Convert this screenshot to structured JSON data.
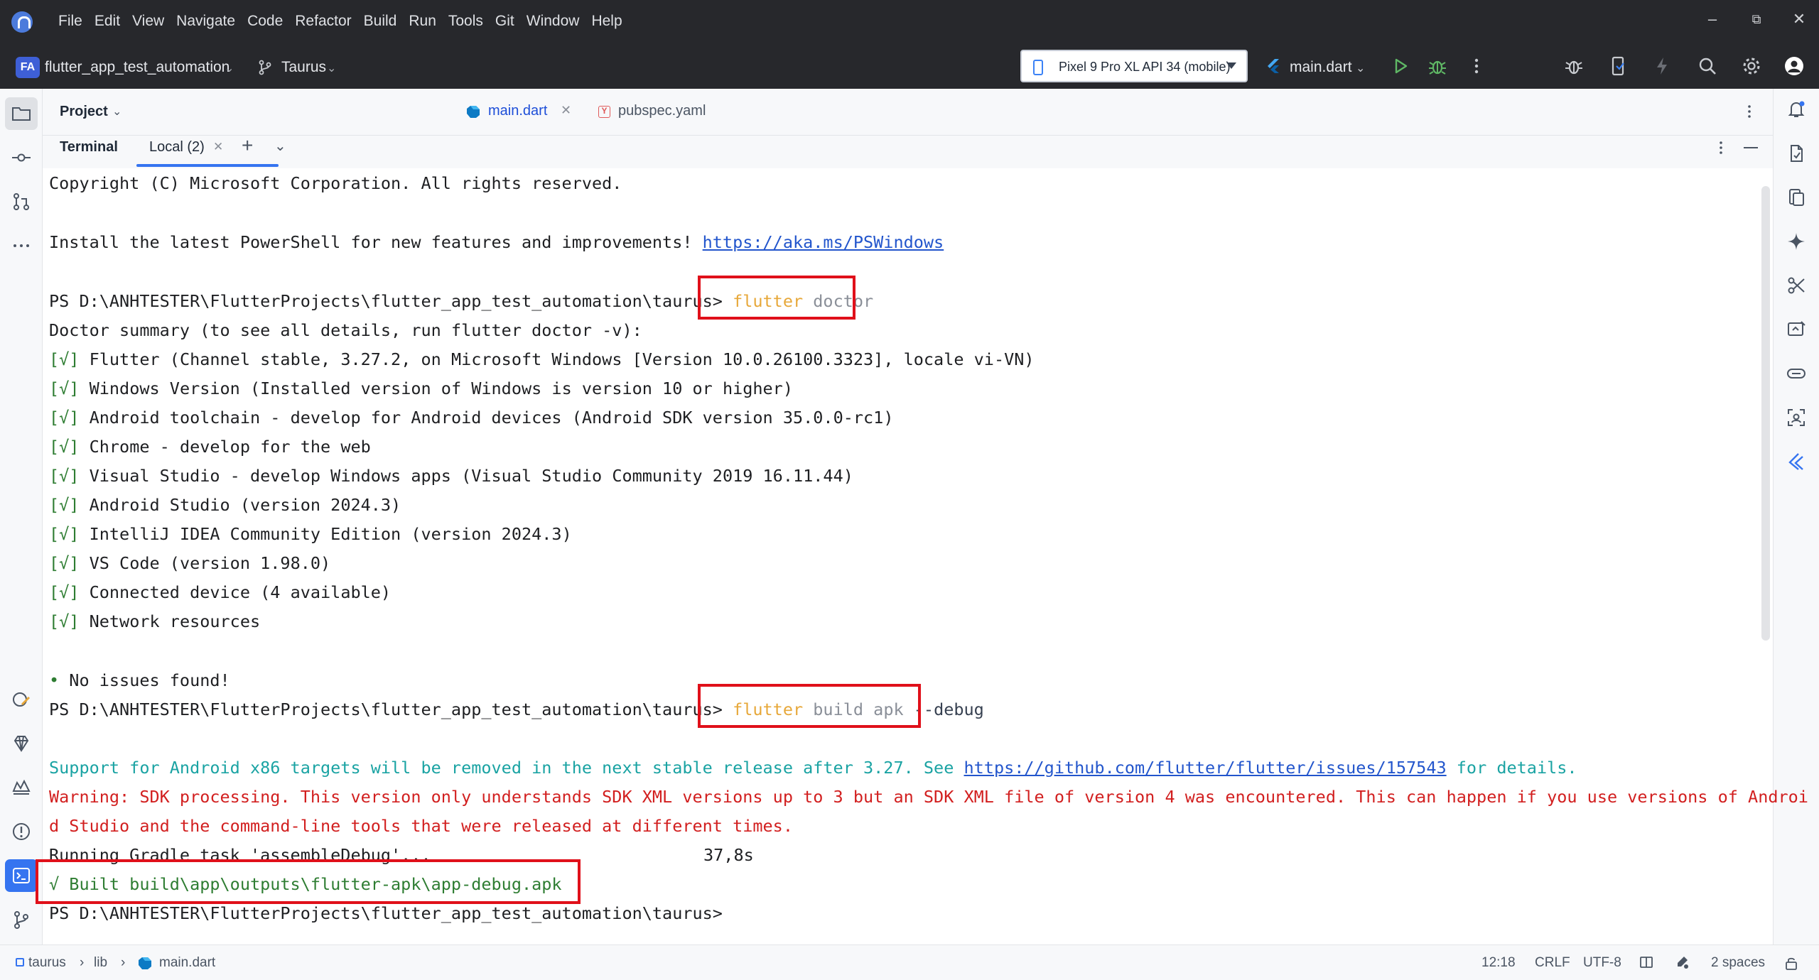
{
  "menu": [
    "File",
    "Edit",
    "View",
    "Navigate",
    "Code",
    "Refactor",
    "Build",
    "Run",
    "Tools",
    "Git",
    "Window",
    "Help"
  ],
  "window_controls": {
    "minimize": "–",
    "restore": "⧉",
    "close": "✕"
  },
  "toolbar": {
    "project_badge": "FA",
    "project_name": "flutter_app_test_automation",
    "branch": "Taurus",
    "device": "Pixel 9 Pro XL API 34 (mobile)",
    "run_config": "main.dart"
  },
  "project_panel": {
    "label": "Project"
  },
  "editor_tabs": [
    {
      "label": "main.dart",
      "icon": "dart-icon",
      "active": true
    },
    {
      "label": "pubspec.yaml",
      "icon": "yaml-icon",
      "active": false
    }
  ],
  "terminal": {
    "title": "Terminal",
    "tab": "Local (2)",
    "lines": {
      "copyright": "Copyright (C) Microsoft Corporation. All rights reserved.",
      "install_prefix": "Install the latest PowerShell for new features and improvements! ",
      "install_link": "https://aka.ms/PSWindows",
      "prompt": "PS D:\\ANHTESTER\\FlutterProjects\\flutter_app_test_automation\\taurus>",
      "cmd1_flutter": "flutter",
      "cmd1_arg": " doctor",
      "doctor_summary": "Doctor summary (to see all details, run flutter doctor -v):",
      "check_mark": "[√]",
      "checks": [
        "Flutter (Channel stable, 3.27.2, on Microsoft Windows [Version 10.0.26100.3323], locale vi-VN)",
        "Windows Version (Installed version of Windows is version 10 or higher)",
        "Android toolchain - develop for Android devices (Android SDK version 35.0.0-rc1)",
        "Chrome - develop for the web",
        "Visual Studio - develop Windows apps (Visual Studio Community 2019 16.11.44)",
        "Android Studio (version 2024.3)",
        "IntelliJ IDEA Community Edition (version 2024.3)",
        "VS Code (version 1.98.0)",
        "Connected device (4 available)",
        "Network resources"
      ],
      "no_issues_bullet": "•",
      "no_issues": " No issues found!",
      "cmd2_flutter": "flutter",
      "cmd2_arg": " build apk",
      "cmd2_flag": " --debug",
      "support_text": "Support for Android x86 targets will be removed in the next stable release after 3.27. See ",
      "support_link": "https://github.com/flutter/flutter/issues/157543",
      "support_suffix": " for details.",
      "warning_1": "Warning: SDK processing. This version only understands SDK XML versions up to 3 but an SDK XML file of version 4 was encountered. This can happen if you use versions of Androi",
      "warning_2": "d Studio and the command-line tools that were released at different times.",
      "gradle_task": "Running Gradle task 'assembleDebug'...",
      "gradle_time": "37,8s",
      "built": "√ Built build\\app\\outputs\\flutter-apk\\app-debug.apk"
    }
  },
  "statusbar": {
    "breadcrumb": [
      "taurus",
      "lib",
      "main.dart"
    ],
    "separator": "›",
    "position": "12:18",
    "line_ending": "CRLF",
    "encoding": "UTF-8",
    "indent": "2 spaces"
  },
  "colors": {
    "chrome_dark": "#27282c",
    "accent": "#3574f0",
    "highlight_box": "#e0101a",
    "ok_green": "#2e7d32",
    "warning_red": "#d21f1f",
    "info_teal": "#1aa3a3",
    "command_orange": "#e7a83a"
  }
}
